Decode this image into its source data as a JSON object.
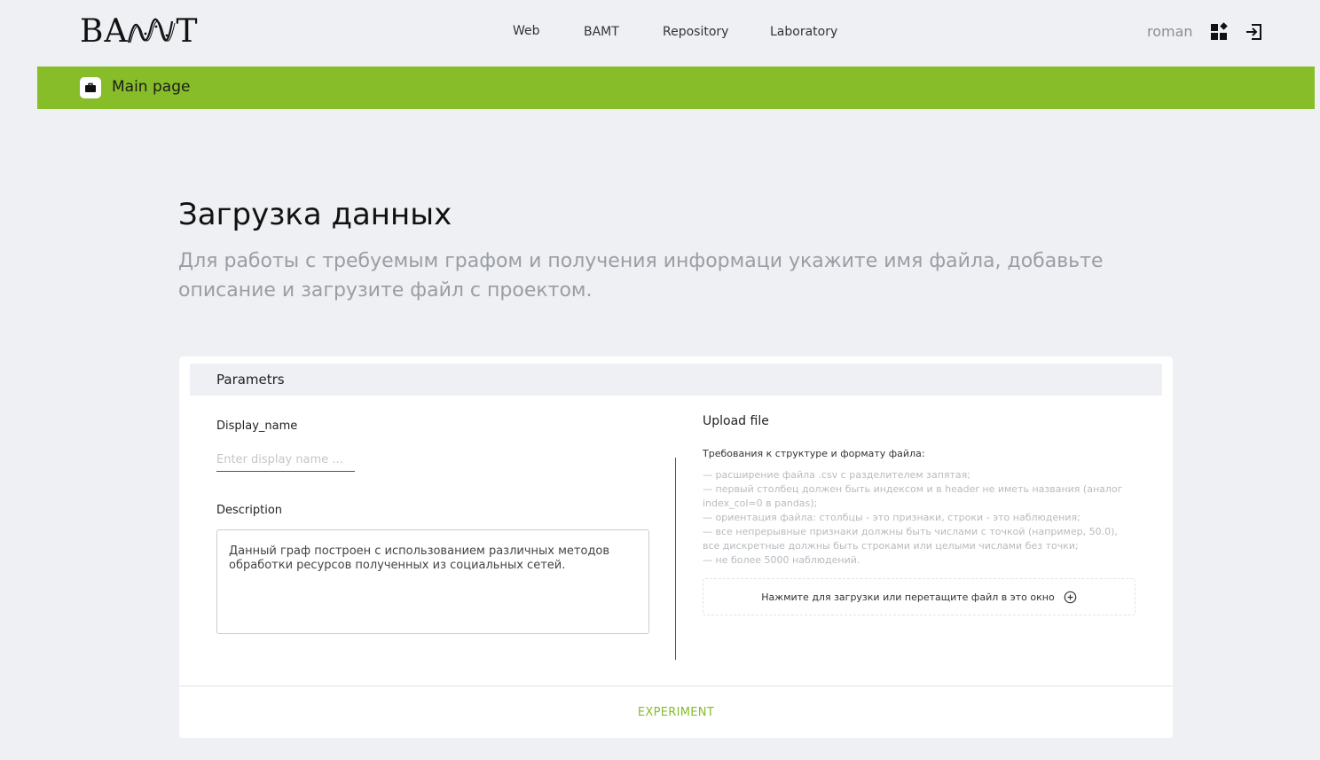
{
  "header": {
    "logo_left": "BA",
    "logo_right": "T",
    "nav": [
      {
        "label": "Web"
      },
      {
        "label": "BAMT"
      },
      {
        "label": "Repository"
      },
      {
        "label": "Laboratory"
      }
    ],
    "username": "roman",
    "icons": [
      "dashboard-icon",
      "logout-icon"
    ]
  },
  "breadcrumb": {
    "icon": "briefcase-icon",
    "label": "Main page"
  },
  "page": {
    "title": "Загрузка данных",
    "subtitle": "Для работы с требуемым графом и получения информаци укажите имя файла, добавьте описание и загрузите файл с проектом."
  },
  "card": {
    "header": "Parametrs",
    "display_name": {
      "label": "Display_name",
      "placeholder": "Enter display name ...",
      "value": ""
    },
    "description": {
      "label": "Description",
      "value": "Данный граф построен с использованием различных методов обработки ресурсов полученных из социальных сетей."
    },
    "upload": {
      "title": "Upload file",
      "requirements_title": "Требования к структуре и формату файла:",
      "requirements": [
        "— расширение файла .csv с разделителем запятая;",
        "— первый столбец должен быть индексом и в header не иметь названия (аналог index_col=0 в pandas);",
        "— ориентация файла: столбцы - это признаки, строки - это наблюдения;",
        "— все непрерывные признаки должны быть числами с точкой (например, 50.0), все дискретные должны быть строками или целыми числами без точки;",
        "— не более 5000 наблюдений."
      ],
      "dropzone_label": "Нажмите для загрузки или перетащите файл в это окно",
      "dropzone_icon": "plus-circle-icon"
    },
    "submit_label": "EXPERIMENT"
  },
  "colors": {
    "accent": "#86bd28",
    "background": "#eef0f3"
  }
}
